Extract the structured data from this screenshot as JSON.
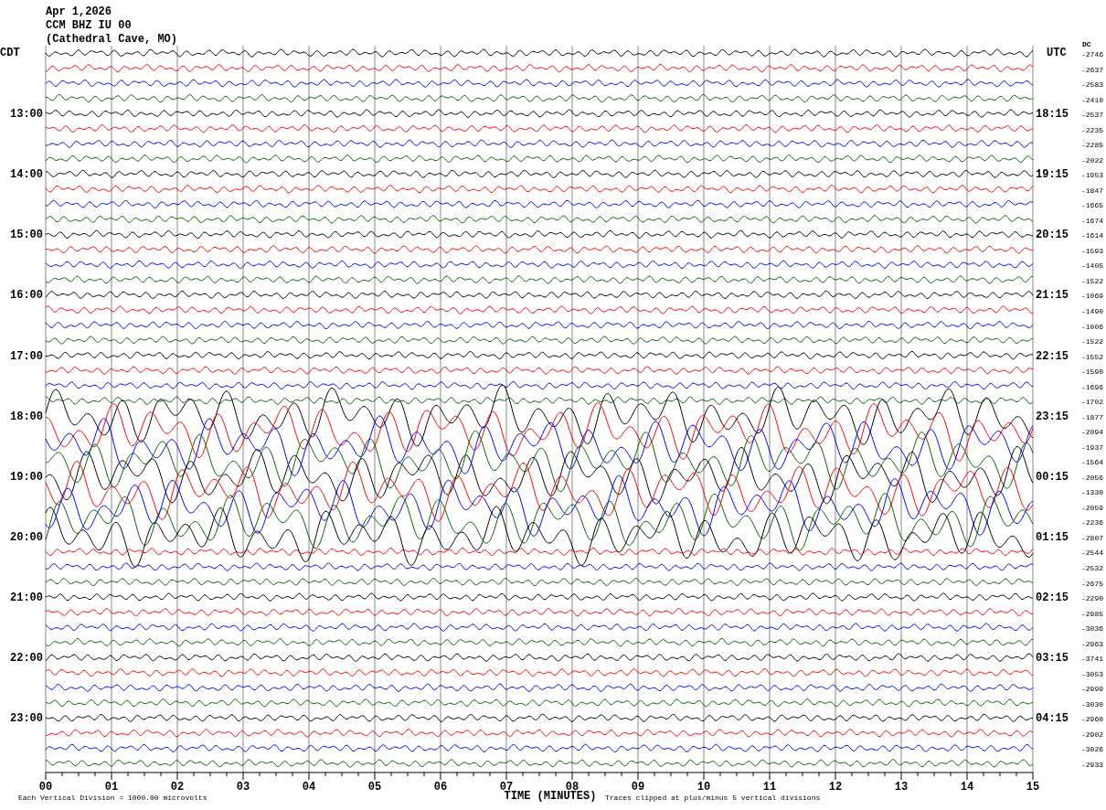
{
  "header": {
    "date": "Apr 1,2026",
    "station": "CCM BHZ IU 00",
    "location": "(Cathedral Cave, MO)"
  },
  "left_axis": {
    "title": "CDT",
    "labels": [
      "13:00",
      "14:00",
      "15:00",
      "16:00",
      "17:00",
      "18:00",
      "19:00",
      "20:00",
      "21:00",
      "22:00",
      "23:00"
    ]
  },
  "right_axis": {
    "title": "UTC",
    "dc_title": "DC",
    "labels": [
      "18:15",
      "19:15",
      "20:15",
      "21:15",
      "22:15",
      "23:15",
      "00:15",
      "01:15",
      "02:15",
      "03:15",
      "04:15"
    ]
  },
  "traces": [
    {
      "color": "#000000",
      "kind": "quiet",
      "dc": "-2746"
    },
    {
      "color": "#ff0000",
      "kind": "quiet",
      "dc": "-2637"
    },
    {
      "color": "#0000ff",
      "kind": "quiet",
      "dc": "-2583"
    },
    {
      "color": "#006400",
      "kind": "quiet",
      "dc": "-2410"
    },
    {
      "color": "#000000",
      "kind": "quiet",
      "dc": "-2537"
    },
    {
      "color": "#ff0000",
      "kind": "quiet",
      "dc": "-2235"
    },
    {
      "color": "#0000ff",
      "kind": "quiet",
      "dc": "-2285"
    },
    {
      "color": "#006400",
      "kind": "quiet",
      "dc": "-2022"
    },
    {
      "color": "#000000",
      "kind": "quiet",
      "dc": "-1953"
    },
    {
      "color": "#ff0000",
      "kind": "quiet",
      "dc": "-1847"
    },
    {
      "color": "#0000ff",
      "kind": "quiet",
      "dc": "-1665"
    },
    {
      "color": "#006400",
      "kind": "quiet",
      "dc": "-1674"
    },
    {
      "color": "#000000",
      "kind": "quiet",
      "dc": "-1614"
    },
    {
      "color": "#ff0000",
      "kind": "quiet",
      "dc": "-1593"
    },
    {
      "color": "#0000ff",
      "kind": "quiet",
      "dc": "-1405"
    },
    {
      "color": "#006400",
      "kind": "quiet",
      "dc": "-1522"
    },
    {
      "color": "#000000",
      "kind": "quiet",
      "dc": "-1069"
    },
    {
      "color": "#ff0000",
      "kind": "quiet",
      "dc": "-1490"
    },
    {
      "color": "#0000ff",
      "kind": "quiet",
      "dc": "-1006"
    },
    {
      "color": "#006400",
      "kind": "quiet",
      "dc": "-1522"
    },
    {
      "color": "#000000",
      "kind": "quiet",
      "dc": "-1552"
    },
    {
      "color": "#ff0000",
      "kind": "quiet",
      "dc": "-1590"
    },
    {
      "color": "#0000ff",
      "kind": "quiet",
      "dc": "-1696"
    },
    {
      "color": "#006400",
      "kind": "quiet",
      "dc": "-1702"
    },
    {
      "color": "#000000",
      "kind": "active",
      "dc": "-1877"
    },
    {
      "color": "#ff0000",
      "kind": "active",
      "dc": "-2094"
    },
    {
      "color": "#0000ff",
      "kind": "active",
      "dc": "-1937"
    },
    {
      "color": "#006400",
      "kind": "active",
      "dc": "-1564"
    },
    {
      "color": "#000000",
      "kind": "active",
      "dc": "-2056"
    },
    {
      "color": "#ff0000",
      "kind": "active",
      "dc": "-1330"
    },
    {
      "color": "#0000ff",
      "kind": "active",
      "dc": "-2059"
    },
    {
      "color": "#006400",
      "kind": "active",
      "dc": "-2236"
    },
    {
      "color": "#000000",
      "kind": "active",
      "dc": "-2807"
    },
    {
      "color": "#ff0000",
      "kind": "quiet",
      "dc": "-2544"
    },
    {
      "color": "#0000ff",
      "kind": "quiet",
      "dc": "-2532"
    },
    {
      "color": "#006400",
      "kind": "quiet",
      "dc": "-2675"
    },
    {
      "color": "#000000",
      "kind": "quiet",
      "dc": "-2290"
    },
    {
      "color": "#ff0000",
      "kind": "quiet",
      "dc": "-2985"
    },
    {
      "color": "#0000ff",
      "kind": "quiet",
      "dc": "-3036"
    },
    {
      "color": "#006400",
      "kind": "quiet",
      "dc": "-2963"
    },
    {
      "color": "#000000",
      "kind": "quiet",
      "dc": "-3741"
    },
    {
      "color": "#ff0000",
      "kind": "quiet",
      "dc": "-3053"
    },
    {
      "color": "#0000ff",
      "kind": "quiet",
      "dc": "-2999"
    },
    {
      "color": "#006400",
      "kind": "quiet",
      "dc": "-3030"
    },
    {
      "color": "#000000",
      "kind": "quiet",
      "dc": "-2960"
    },
    {
      "color": "#ff0000",
      "kind": "quiet",
      "dc": "-2902"
    },
    {
      "color": "#0000ff",
      "kind": "quiet",
      "dc": "-3026"
    },
    {
      "color": "#006400",
      "kind": "quiet",
      "dc": "-2933"
    }
  ],
  "x_axis": {
    "ticks": [
      "00",
      "01",
      "02",
      "03",
      "04",
      "05",
      "06",
      "07",
      "08",
      "09",
      "10",
      "11",
      "12",
      "13",
      "14",
      "15"
    ],
    "title": "TIME (MINUTES)"
  },
  "footer": {
    "scale_note": "Each Vertical Division = 1000.00 microvolts",
    "clip_note": "Traces clipped at plus/minus 5 vertical divisions"
  }
}
